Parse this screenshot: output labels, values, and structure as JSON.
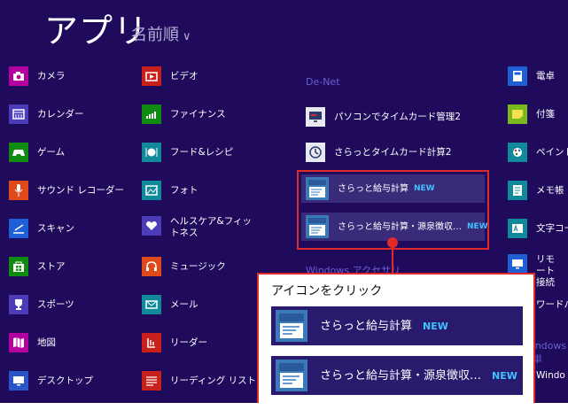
{
  "header": {
    "title": "アプリ",
    "sort": "名前順",
    "sort_chevron": "∨"
  },
  "groups": {
    "denet": "De-Net",
    "accessories": "Windows アクセサリ",
    "ease": "Windows 簡単"
  },
  "col1": [
    "カメラ",
    "カレンダー",
    "ゲーム",
    "サウンド レコーダー",
    "スキャン",
    "ストア",
    "スポーツ",
    "地図",
    "デスクトップ"
  ],
  "col2": [
    "ビデオ",
    "ファイナンス",
    "フード&レシピ",
    "フォト",
    "ヘルスケア&フィットネス",
    "ミュージック",
    "メール",
    "リーダー",
    "リーディング リスト"
  ],
  "col3": [
    "パソコンでタイムカード管理2",
    "さらっとタイムカード計算2"
  ],
  "col4": [
    "電卓",
    "付箋",
    "ペイント",
    "メモ帳",
    "文字コード",
    "リモート接続",
    "ワードパ",
    "Windo"
  ],
  "highlighted": [
    {
      "label": "さらっと給与計算",
      "badge": "NEW",
      "tile_text": "給与計算"
    },
    {
      "label": "さらっと給与計算・源泉徴収…",
      "badge": "NEW",
      "tile_text": "源泉徴収"
    }
  ],
  "callout": {
    "title": "アイコンをクリック"
  },
  "colors": {
    "bg": "#1f0a5c",
    "accent_red": "#e02a2a",
    "new_blue": "#3fc3ff"
  }
}
